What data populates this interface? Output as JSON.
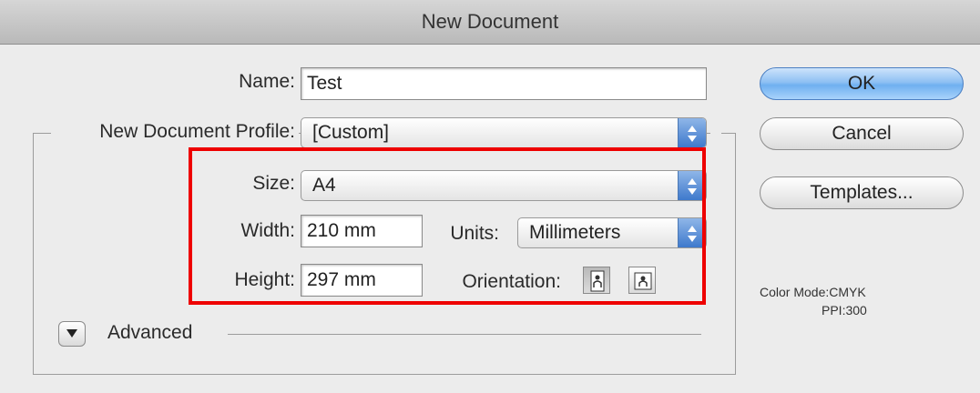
{
  "window": {
    "title": "New Document"
  },
  "form": {
    "name_label": "Name:",
    "name_value": "Test",
    "profile_label": "New Document Profile:",
    "profile_value": "[Custom]",
    "size_label": "Size:",
    "size_value": "A4",
    "width_label": "Width:",
    "width_value": "210 mm",
    "units_label": "Units:",
    "units_value": "Millimeters",
    "height_label": "Height:",
    "height_value": "297 mm",
    "orientation_label": "Orientation:",
    "orientation_selected": "portrait",
    "advanced_label": "Advanced"
  },
  "buttons": {
    "ok": "OK",
    "cancel": "Cancel",
    "templates": "Templates..."
  },
  "info": {
    "color_mode": "Color Mode:CMYK",
    "ppi": "PPI:300"
  },
  "colors": {
    "highlight": "#ee0000",
    "default_button": "#6fb0f0",
    "select_arrow": "#3e79cc"
  }
}
